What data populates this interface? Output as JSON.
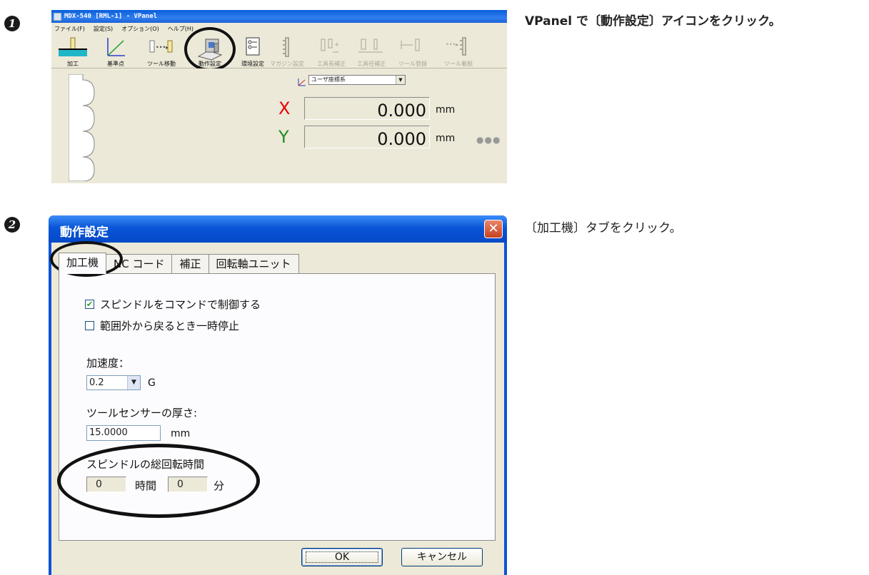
{
  "steps": [
    {
      "number": "1",
      "instruction": "VPanel で〔動作設定〕アイコンをクリック。"
    },
    {
      "number": "2",
      "instruction": "〔加工機〕タブをクリック。"
    }
  ],
  "vpanel": {
    "title": "MDX-540  [RML-1] - VPanel",
    "menu": [
      "ファイル(F)",
      "設定(S)",
      "オプション(O)",
      "ヘルプ(H)"
    ],
    "toolbar": [
      {
        "label": "加工",
        "icon": "cutting-icon",
        "enabled": true
      },
      {
        "label": "基準点",
        "icon": "origin-point-icon",
        "enabled": true
      },
      {
        "label": "ツール移動",
        "icon": "tool-move-icon",
        "enabled": true
      },
      {
        "label": "動作設定",
        "icon": "machine-settings-icon",
        "enabled": true
      },
      {
        "label": "環境設定",
        "icon": "preferences-icon",
        "enabled": true
      },
      {
        "label": "マガジン設定",
        "icon": "magazine-icon",
        "enabled": false
      },
      {
        "label": "工具長補正",
        "icon": "tool-length-icon",
        "enabled": false
      },
      {
        "label": "工具径補正",
        "icon": "tool-diameter-icon",
        "enabled": false
      },
      {
        "label": "ツール登録",
        "icon": "tool-register-icon",
        "enabled": false
      },
      {
        "label": "ツール着脱",
        "icon": "tool-change-icon",
        "enabled": false
      }
    ],
    "coordinate_system": "ユーザ座標系",
    "axes": [
      {
        "axis": "X",
        "value": "0.000",
        "unit": "mm"
      },
      {
        "axis": "Y",
        "value": "0.000",
        "unit": "mm"
      }
    ],
    "colors": {
      "title_bar": "#0a5fd8",
      "axis_x": "#e60000",
      "axis_y": "#228b22"
    }
  },
  "dialog": {
    "title": "動作設定",
    "close_symbol": "✕",
    "tabs": [
      "加工機",
      "NC コード",
      "補正",
      "回転軸ユニット"
    ],
    "active_tab": "加工機",
    "checkboxes": [
      {
        "label": "スピンドルをコマンドで制御する",
        "checked": true,
        "mark": "✔"
      },
      {
        "label": "範囲外から戻るとき一時停止",
        "checked": false,
        "mark": ""
      }
    ],
    "acceleration": {
      "label": "加速度：",
      "value": "0.2",
      "unit": "G"
    },
    "sensor_thickness": {
      "label": "ツールセンサーの厚さ:",
      "value": "15.0000",
      "unit": "mm"
    },
    "spindle_total": {
      "label": "スピンドルの総回転時間",
      "hours": "0",
      "hours_unit": "時間",
      "minutes": "0",
      "minutes_unit": "分"
    },
    "buttons": {
      "ok": "OK",
      "cancel": "キャンセル"
    },
    "colors": {
      "title_bar": "#0a54d6",
      "close_button": "#d2522f",
      "face": "#ece9d8"
    }
  }
}
